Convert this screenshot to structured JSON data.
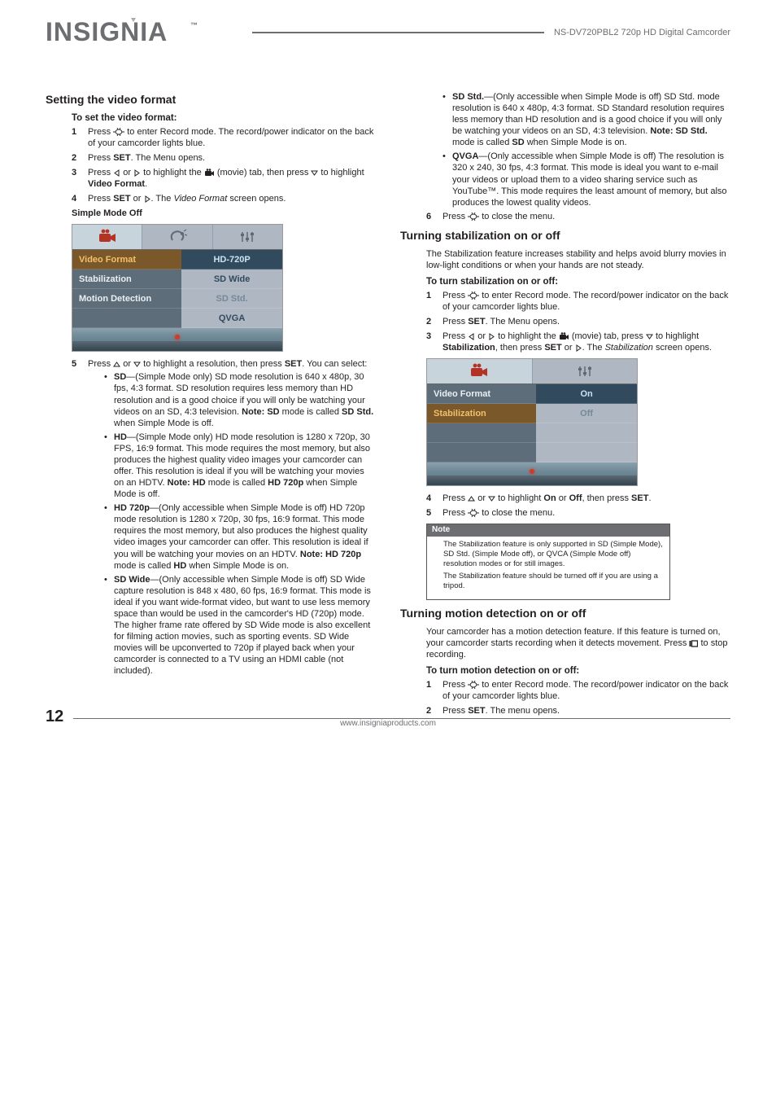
{
  "meta": {
    "product_title": "NS-DV720PBL2 720p HD Digital Camcorder",
    "page_number": "12",
    "footer_url": "www.insigniaproducts.com"
  },
  "left": {
    "h_setting_video_format": "Setting the video format",
    "h_to_set": "To set the video format:",
    "step1_a": "Press ",
    "step1_b": " to enter Record mode. The record/power indicator on the back of your camcorder lights blue.",
    "step2_a": "Press ",
    "step2_b": "SET",
    "step2_c": ". The Menu opens.",
    "step3_a": "Press ",
    "step3_b": " or ",
    "step3_c": " to highlight the ",
    "step3_d": " (movie) tab, then press ",
    "step3_e": " to highlight ",
    "step3_f": "Video Format",
    "step3_g": ".",
    "step4_a": "Press ",
    "step4_b": "SET",
    "step4_c": " or ",
    "step4_d": ". The ",
    "step4_e": "Video Format",
    "step4_f": " screen opens.",
    "simple_mode_off": "Simple Mode Off",
    "screenshot1": {
      "menu_left": [
        "Video Format",
        "Stabilization",
        "Motion Detection"
      ],
      "menu_right": [
        "HD-720P",
        "SD Wide",
        "SD Std.",
        "QVGA"
      ]
    },
    "step5_a": "Press ",
    "step5_b": " or ",
    "step5_c": " to highlight a resolution, then press ",
    "step5_d": "SET",
    "step5_e": ". You can select:",
    "bullets": {
      "sd_lbl": "SD",
      "sd_txt": "—(Simple Mode only) SD mode resolution is 640 x 480p, 30 fps, 4:3 format. SD resolution requires less memory than HD resolution and is a good choice if you will only be watching your videos on an SD, 4:3 television. ",
      "sd_note_lbl": "Note: SD",
      "sd_note_txt": " mode is called ",
      "sd_note_bold": "SD Std.",
      "sd_note_tail": " when Simple Mode is off.",
      "hd_lbl": "HD",
      "hd_txt": "—(Simple Mode only) HD mode resolution is 1280 x 720p, 30 FPS, 16:9 format. This mode requires the most memory, but also produces the highest quality video images your camcorder can offer. This resolution is ideal if you will be watching your movies on an HDTV. ",
      "hd_note_lbl": "Note: HD",
      "hd_note_txt": " mode is called ",
      "hd_note_bold": "HD 720p",
      "hd_note_tail": " when Simple Mode is off.",
      "hd720_lbl": "HD 720p",
      "hd720_txt": "—(Only accessible when Simple Mode is off) HD 720p mode resolution is 1280 x 720p, 30 fps, 16:9 format. This mode requires the most memory, but also produces the highest quality video images your camcorder can offer. This resolution is ideal if you will be watching your movies on an HDTV. ",
      "hd720_note_lbl": "Note: HD 720p",
      "hd720_note_txt": " mode is called ",
      "hd720_note_bold": "HD",
      "hd720_note_tail": " when Simple Mode is on.",
      "sdwide_lbl": "SD Wide",
      "sdwide_txt": "—(Only accessible when Simple Mode is off) SD Wide capture resolution is 848 x 480, 60 fps, 16:9 format. This mode is ideal if you want wide-format video, but want to use less memory space than would be used in the camcorder's HD (720p) mode. The higher frame rate offered by SD Wide mode is also excellent for filming action movies, such as sporting events. SD Wide movies will be upconverted to 720p if played back when your camcorder is connected to a TV using an HDMI cable (not included)."
    }
  },
  "right": {
    "bullets_cont": {
      "sdstd_lbl": "SD Std.",
      "sdstd_txt": "—(Only accessible when Simple Mode is off) SD Std. mode resolution is 640 x 480p, 4:3 format. SD Standard resolution requires less memory than HD resolution and is a good choice if you will only be watching your videos on an SD, 4:3 television. ",
      "sdstd_note_lbl": "Note: SD Std.",
      "sdstd_note_txt": " mode is called ",
      "sdstd_note_bold": "SD",
      "sdstd_note_tail": " when Simple Mode is on.",
      "qvga_lbl": "QVGA",
      "qvga_txt": "—(Only accessible when Simple Mode is off) The resolution is 320 x 240, 30 fps, 4:3 format. This mode is ideal you want to e-mail your videos or upload them to a video sharing service such as YouTube™. This mode requires the least amount of memory, but also produces the lowest quality videos."
    },
    "step6_a": "Press ",
    "step6_b": " to close the menu.",
    "h_stabilization": "Turning stabilization on or off",
    "stab_intro": "The Stabilization feature increases stability and helps avoid blurry movies in low-light conditions or when your hands are not steady.",
    "h_to_turn_stab": "To turn stabilization on or off:",
    "stab_step1_a": "Press ",
    "stab_step1_b": " to enter Record mode. The record/power indicator on the back of your camcorder lights blue.",
    "stab_step2_a": "Press ",
    "stab_step2_b": "SET",
    "stab_step2_c": ". The Menu opens.",
    "stab_step3_a": "Press ",
    "stab_step3_b": " or ",
    "stab_step3_c": " to highlight the ",
    "stab_step3_d": " (movie) tab, press ",
    "stab_step3_e": " to highlight ",
    "stab_step3_f": "Stabilization",
    "stab_step3_g": ", then press ",
    "stab_step3_h": "SET",
    "stab_step3_i": " or ",
    "stab_step3_j": ". The ",
    "stab_step3_k": "Stabilization",
    "stab_step3_l": " screen opens.",
    "screenshot2": {
      "menu_left": [
        "Video Format",
        "Stabilization"
      ],
      "menu_right": [
        "On",
        "Off"
      ]
    },
    "stab_step4_a": "Press ",
    "stab_step4_b": " or ",
    "stab_step4_c": " to highlight ",
    "stab_step4_d": "On",
    "stab_step4_e": " or ",
    "stab_step4_f": "Off",
    "stab_step4_g": ", then press ",
    "stab_step4_h": "SET",
    "stab_step4_i": ".",
    "stab_step5_a": "Press ",
    "stab_step5_b": " to close the menu.",
    "note_head": "Note",
    "note_p1": "The Stabilization feature is only supported in SD (Simple Mode), SD Std. (Simple Mode off), or QVCA (Simple Mode off) resolution modes or for still images.",
    "note_p2": "The Stabilization feature should be turned off if you are using a tripod.",
    "h_motion": "Turning motion detection on or off",
    "motion_intro_a": "Your camcorder has a motion detection feature. If this feature is turned on, your camcorder starts recording when it detects movement. Press ",
    "motion_intro_b": " to stop recording.",
    "h_to_turn_motion": "To turn motion detection on or off:",
    "motion_step1_a": "Press ",
    "motion_step1_b": " to enter Record mode. The record/power indicator on the back of your camcorder lights blue.",
    "motion_step2_a": "Press ",
    "motion_step2_b": "SET",
    "motion_step2_c": ". The menu opens."
  }
}
